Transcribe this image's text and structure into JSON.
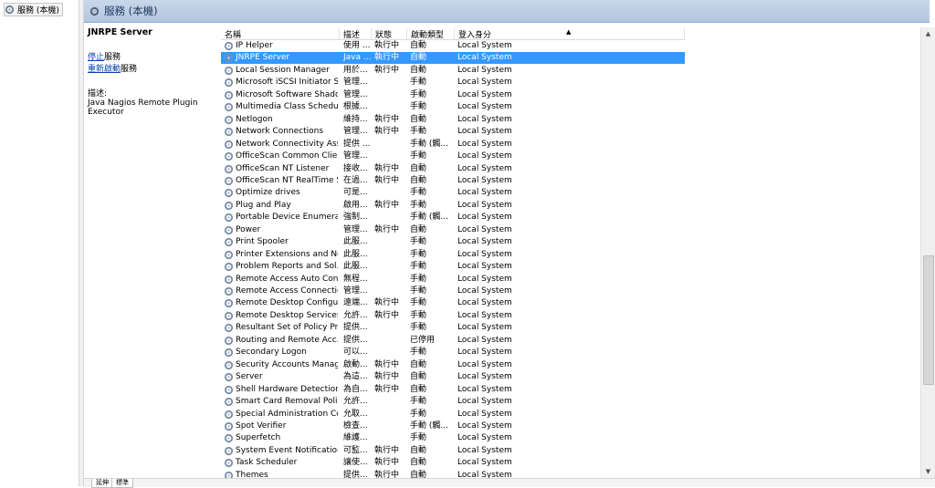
{
  "tree": {
    "label": "服務 (本機)"
  },
  "banner": {
    "title": "服務 (本機)"
  },
  "detail": {
    "service_name": "JNRPE Server",
    "stop_link": "停止",
    "stop_suffix": "服務",
    "restart_link": "重新啟動",
    "restart_suffix": "服務",
    "desc_label": "描述:",
    "desc_text": "Java Nagios Remote Plugin Executor"
  },
  "columns": {
    "name": "名稱",
    "description": "描述",
    "status": "狀態",
    "startup": "啟動類型",
    "logon": "登入身分"
  },
  "rows": [
    {
      "name": "IP Helper",
      "desc": "使用 ...",
      "status": "執行中",
      "startup": "自動",
      "logon": "Local System"
    },
    {
      "name": "JNRPE Server",
      "desc": "Java ...",
      "status": "執行中",
      "startup": "自動",
      "logon": "Local System"
    },
    {
      "name": "Local Session Manager",
      "desc": "用於...",
      "status": "執行中",
      "startup": "自動",
      "logon": "Local System"
    },
    {
      "name": "Microsoft iSCSI Initiator S...",
      "desc": "管理...",
      "status": "",
      "startup": "手動",
      "logon": "Local System"
    },
    {
      "name": "Microsoft Software Shado...",
      "desc": "管理...",
      "status": "",
      "startup": "手動",
      "logon": "Local System"
    },
    {
      "name": "Multimedia Class Scheduler",
      "desc": "根據...",
      "status": "",
      "startup": "手動",
      "logon": "Local System"
    },
    {
      "name": "Netlogon",
      "desc": "維持...",
      "status": "執行中",
      "startup": "自動",
      "logon": "Local System"
    },
    {
      "name": "Network Connections",
      "desc": "管理...",
      "status": "執行中",
      "startup": "手動",
      "logon": "Local System"
    },
    {
      "name": "Network Connectivity Assi...",
      "desc": "提供 ...",
      "status": "",
      "startup": "手動 (觸...",
      "logon": "Local System"
    },
    {
      "name": "OfficeScan Common Clie...",
      "desc": "管理...",
      "status": "",
      "startup": "手動",
      "logon": "Local System"
    },
    {
      "name": "OfficeScan NT Listener",
      "desc": "接收...",
      "status": "執行中",
      "startup": "自動",
      "logon": "Local System"
    },
    {
      "name": "OfficeScan NT RealTime S...",
      "desc": "在過...",
      "status": "執行中",
      "startup": "自動",
      "logon": "Local System"
    },
    {
      "name": "Optimize drives",
      "desc": "可是...",
      "status": "",
      "startup": "手動",
      "logon": "Local System"
    },
    {
      "name": "Plug and Play",
      "desc": "啟用...",
      "status": "執行中",
      "startup": "手動",
      "logon": "Local System"
    },
    {
      "name": "Portable Device Enumerat...",
      "desc": "強制...",
      "status": "",
      "startup": "手動 (觸...",
      "logon": "Local System"
    },
    {
      "name": "Power",
      "desc": "管理...",
      "status": "執行中",
      "startup": "自動",
      "logon": "Local System"
    },
    {
      "name": "Print Spooler",
      "desc": "此服...",
      "status": "",
      "startup": "手動",
      "logon": "Local System"
    },
    {
      "name": "Printer Extensions and No...",
      "desc": "此服...",
      "status": "",
      "startup": "手動",
      "logon": "Local System"
    },
    {
      "name": "Problem Reports and Sol...",
      "desc": "此服...",
      "status": "",
      "startup": "手動",
      "logon": "Local System"
    },
    {
      "name": "Remote Access Auto Con...",
      "desc": "無程...",
      "status": "",
      "startup": "手動",
      "logon": "Local System"
    },
    {
      "name": "Remote Access Connectio...",
      "desc": "管理...",
      "status": "",
      "startup": "手動",
      "logon": "Local System"
    },
    {
      "name": "Remote Desktop Configur...",
      "desc": "遠端...",
      "status": "執行中",
      "startup": "手動",
      "logon": "Local System"
    },
    {
      "name": "Remote Desktop Services ...",
      "desc": "允許...",
      "status": "執行中",
      "startup": "手動",
      "logon": "Local System"
    },
    {
      "name": "Resultant Set of Policy Pro...",
      "desc": "提供...",
      "status": "",
      "startup": "手動",
      "logon": "Local System"
    },
    {
      "name": "Routing and Remote Acc...",
      "desc": "提供...",
      "status": "",
      "startup": "已停用",
      "logon": "Local System"
    },
    {
      "name": "Secondary Logon",
      "desc": "可以...",
      "status": "",
      "startup": "手動",
      "logon": "Local System"
    },
    {
      "name": "Security Accounts Manager",
      "desc": "啟動...",
      "status": "執行中",
      "startup": "自動",
      "logon": "Local System"
    },
    {
      "name": "Server",
      "desc": "為這...",
      "status": "執行中",
      "startup": "自動",
      "logon": "Local System"
    },
    {
      "name": "Shell Hardware Detection",
      "desc": "為自...",
      "status": "執行中",
      "startup": "自動",
      "logon": "Local System"
    },
    {
      "name": "Smart Card Removal Policy",
      "desc": "允許...",
      "status": "",
      "startup": "手動",
      "logon": "Local System"
    },
    {
      "name": "Special Administration Co...",
      "desc": "允取...",
      "status": "",
      "startup": "手動",
      "logon": "Local System"
    },
    {
      "name": "Spot Verifier",
      "desc": "檢查...",
      "status": "",
      "startup": "手動 (觸...",
      "logon": "Local System"
    },
    {
      "name": "Superfetch",
      "desc": "維護...",
      "status": "",
      "startup": "手動",
      "logon": "Local System"
    },
    {
      "name": "System Event Notification ...",
      "desc": "可監...",
      "status": "執行中",
      "startup": "自動",
      "logon": "Local System"
    },
    {
      "name": "Task Scheduler",
      "desc": "讓使...",
      "status": "執行中",
      "startup": "自動",
      "logon": "Local System"
    },
    {
      "name": "Themes",
      "desc": "提供...",
      "status": "執行中",
      "startup": "自動",
      "logon": "Local System"
    }
  ],
  "selected_row": "JNRPE Server",
  "tabs": [
    "延伸",
    "標準"
  ],
  "colors": {
    "selection": "#3399ff",
    "banner_text": "#1e395b",
    "link": "#0645ad"
  }
}
